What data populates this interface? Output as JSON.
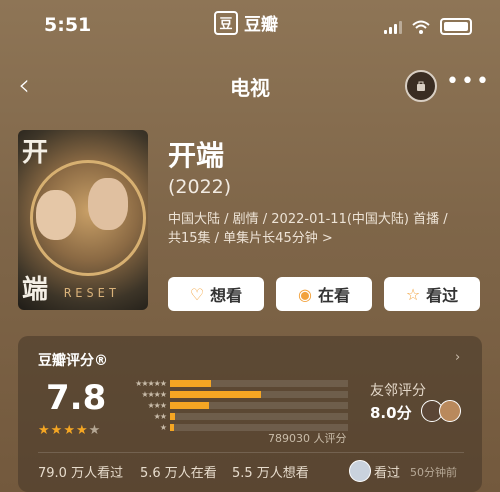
{
  "status_bar": {
    "time": "5:51",
    "app_name": "豆瓣",
    "app_icon_char": "豆"
  },
  "nav": {
    "title": "电视",
    "more": "•••"
  },
  "poster": {
    "title_top": "开",
    "title_bottom": "端",
    "subtitle": "RESET"
  },
  "show": {
    "title": "开端",
    "year": "(2022)",
    "meta_line1": "中国大陆 / 剧情 / 2022-01-11(中国大陆) 首播 /",
    "meta_line2": "共15集 / 单集片长45分钟 >"
  },
  "actions": [
    {
      "label": "想看",
      "icon": "heart-plus-icon"
    },
    {
      "label": "在看",
      "icon": "record-icon"
    },
    {
      "label": "看过",
      "icon": "star-outline-icon"
    }
  ],
  "rating": {
    "label": "豆瓣评分®",
    "score": "7.8",
    "stars_on": 4,
    "votes": "789030 人评分",
    "distribution": [
      0.23,
      0.51,
      0.22,
      0.03,
      0.02
    ],
    "accent": "#f5a623"
  },
  "friends": {
    "label": "友邻评分",
    "score": "8.0分"
  },
  "stats": {
    "watched": "79.0 万人看过",
    "watching": "5.6 万人在看",
    "want": "5.5 万人想看"
  },
  "activity": {
    "label": "看过",
    "time": "50分钟前"
  }
}
